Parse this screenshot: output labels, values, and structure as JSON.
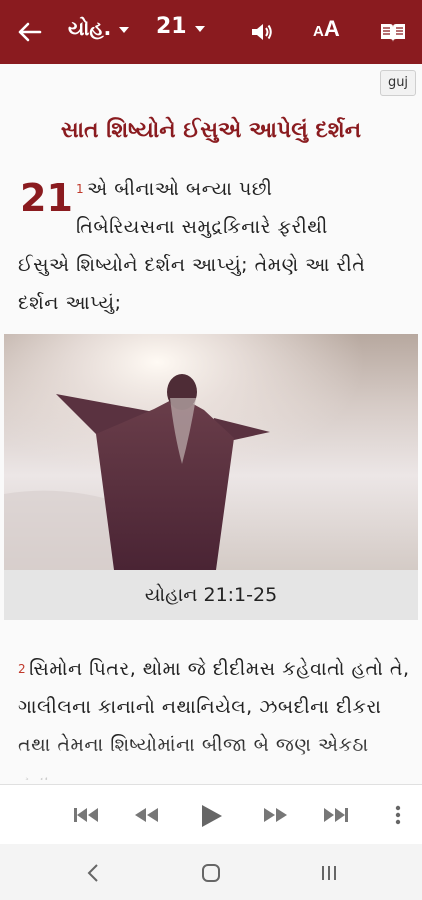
{
  "toolbar": {
    "book_label": "યોહ.",
    "chapter_label": "21"
  },
  "font_button": {
    "small": "A",
    "large": "A"
  },
  "language_badge": "guj",
  "section_heading": "સાત શિષ્યોને ઈસુએ આપેલું દર્શન",
  "chapter_number": "21",
  "verse1": {
    "number": "1",
    "line1": "એ બીનાઓ બન્યા પછી",
    "line2": "તિબેરિયસના સમુદ્રકિનારે ફરીથી",
    "rest": "ઈસુએ શિષ્યોને દર્શન આપ્યું; તેમણે આ રીતે દર્શન આપ્યું;"
  },
  "image_caption": "યોહાન 21:1-25",
  "verse2": {
    "number": "2",
    "text": "સિમોન પિતર, થોમા જે દીદીમસ કહેવાતો હતો તે, ગાલીલના કાનાનો નથાનિયેલ, ઝબદીના દીકરા તથા તેમના શિષ્યોમાંના બીજા બે જણ એકઠા હતા."
  },
  "icons": {
    "back": "arrow-left-icon",
    "audio": "speaker-icon",
    "book": "book-icon",
    "player": [
      "skip-previous-icon",
      "rewind-icon",
      "play-icon",
      "fast-forward-icon",
      "skip-next-icon",
      "more-vertical-icon"
    ],
    "nav": [
      "system-back-icon",
      "system-home-icon",
      "system-recents-icon"
    ]
  },
  "colors": {
    "brand": "#8a1b1f",
    "verse_number": "#c0392b",
    "caption_bg": "#e5e5e5"
  }
}
